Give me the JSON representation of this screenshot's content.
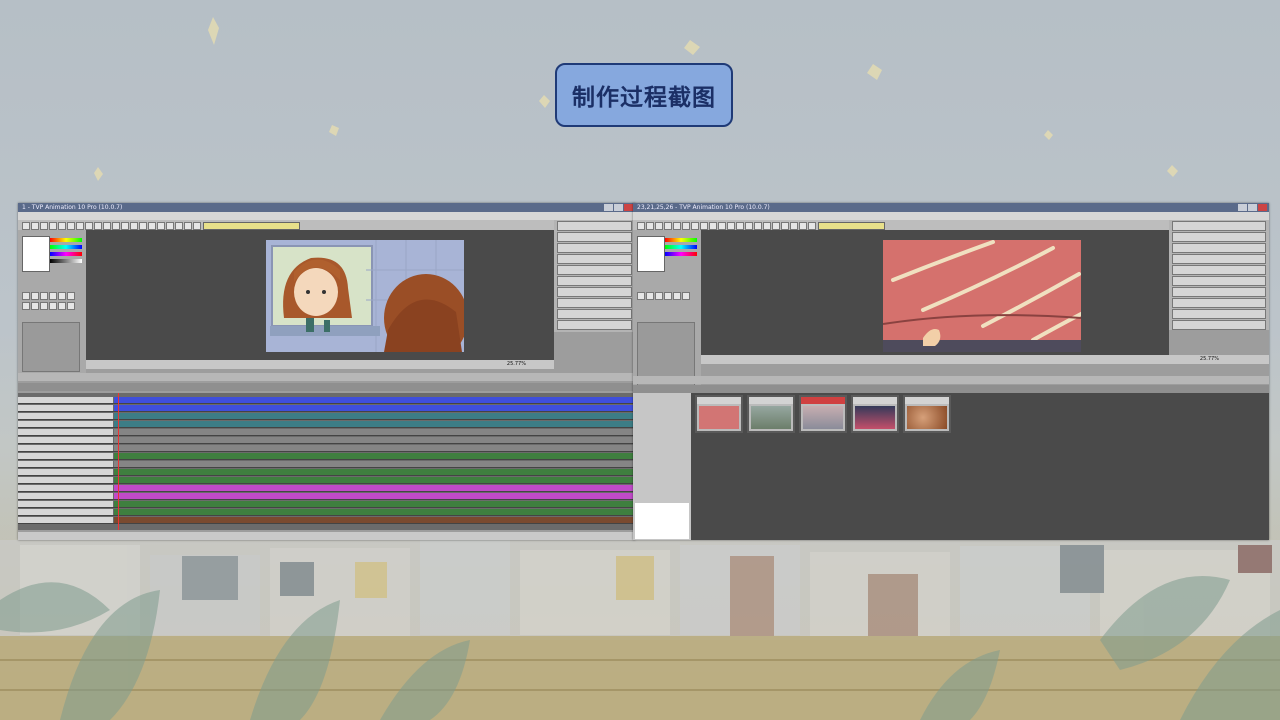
{
  "slide": {
    "title": "制作过程截图"
  },
  "left_window": {
    "title": "1 - TVP Animation 10 Pro (10.0.7)",
    "zoom": "25.77%"
  },
  "right_window": {
    "title": "23,21,25,26 - TVP Animation 10 Pro (10.0.7)",
    "zoom": "25.77%"
  },
  "colors": {
    "title_box_fill": "#86a8de",
    "title_text": "#1b2f66",
    "track_blue": "#3f4fdc",
    "track_teal": "#3c7d86",
    "track_green": "#3f7f3f",
    "track_magenta": "#c04ac8",
    "track_brown": "#7a4a2f"
  },
  "icons": [
    "minimize-icon",
    "maximize-icon",
    "close-icon",
    "star-sparkle-icon"
  ]
}
